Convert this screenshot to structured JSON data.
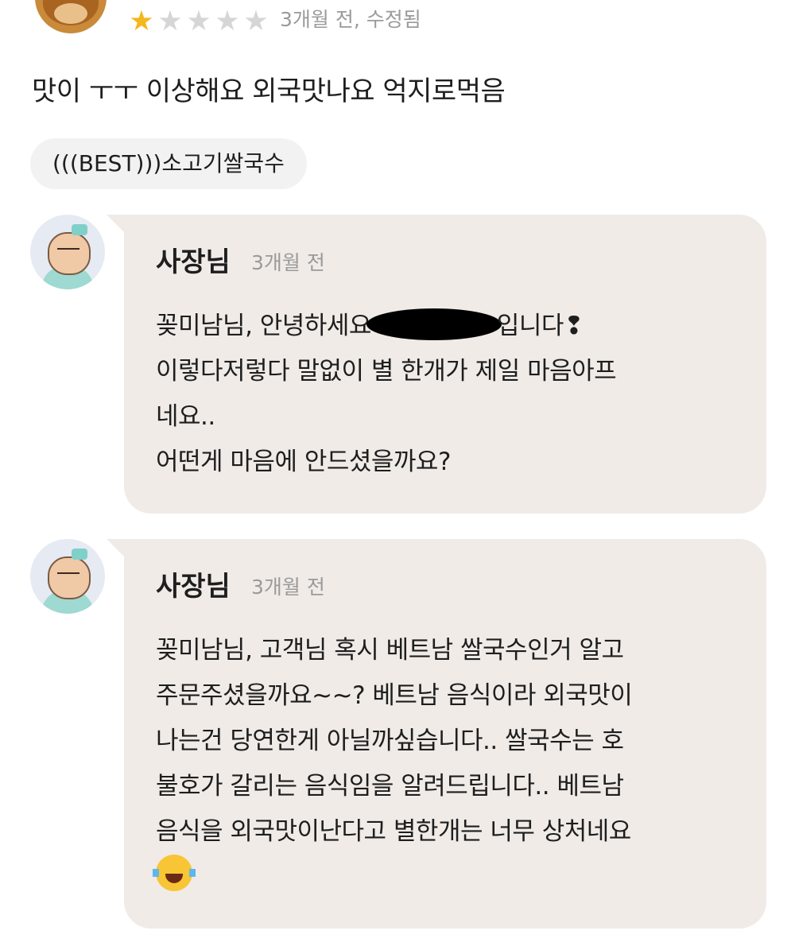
{
  "review": {
    "rating": 1,
    "max_rating": 5,
    "meta": "3개월 전, 수정됨",
    "text": "맛이 ㅜㅜ 이상해요 외국맛나요 억지로먹음",
    "menu_item": "(((BEST)))소고기쌀국수"
  },
  "replies": [
    {
      "author": "사장님",
      "time": "3개월 전",
      "lines": [
        {
          "pre": "꽂미남님, 안녕하세요",
          "post": "입니다❢"
        },
        {
          "text": "이렇다저렇다 말없이 별 한개가 제일 마음아프"
        },
        {
          "text": "네요.."
        },
        {
          "text": "어떤게 마음에 안드셨을까요?"
        }
      ]
    },
    {
      "author": "사장님",
      "time": "3개월 전",
      "lines": [
        {
          "text": "꽂미남님, 고객님 혹시 베트남 쌀국수인거 알고"
        },
        {
          "text": "주문주셨을까요~~? 베트남 음식이라 외국맛이"
        },
        {
          "text": "나는건 당연한게 아닐까싶습니다.. 쌀국수는 호"
        },
        {
          "text": "불호가 갈리는 음식임을 알려드립니다.. 베트남"
        },
        {
          "text": "음식을 외국맛이난다고 별한개는 너무 상처네요"
        }
      ],
      "emoji": "face-with-tears-of-joy-icon"
    }
  ],
  "colors": {
    "star_filled": "#f4b81c",
    "star_empty": "#d6d6d6",
    "bubble_bg": "#f0ebe7",
    "chip_bg": "#f2f2f2",
    "muted_text": "#9a9a9a"
  }
}
